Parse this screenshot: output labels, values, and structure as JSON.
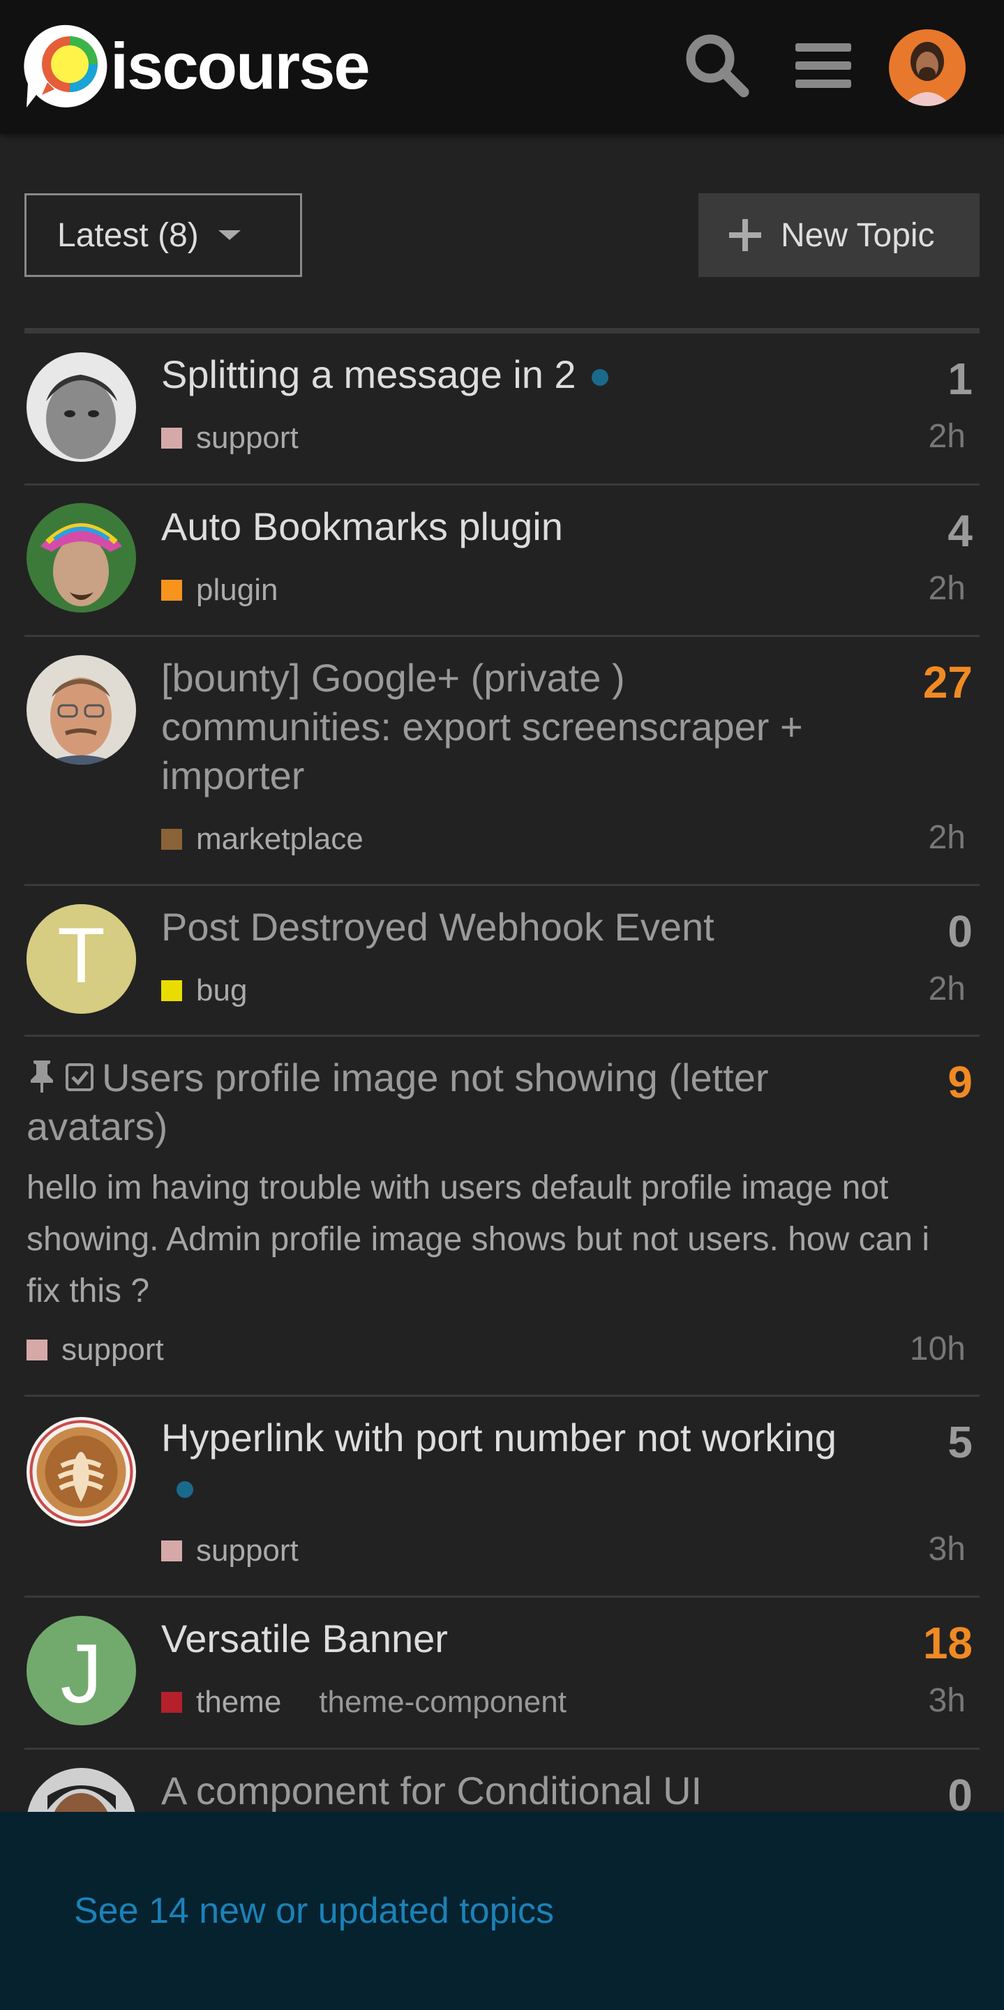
{
  "header": {
    "logo_text": "iscourse",
    "search_icon": "search-icon",
    "menu_icon": "hamburger-menu-icon",
    "avatar_icon": "user-avatar"
  },
  "controls": {
    "filter_label": "Latest (8)",
    "new_topic_label": "New Topic"
  },
  "topics": [
    {
      "title": "Splitting a message in 2",
      "category": "support",
      "category_color": "#d6a9a9",
      "posts": "1",
      "age": "2h",
      "unread_dot": true,
      "read": false,
      "hot": false
    },
    {
      "title": "Auto Bookmarks plugin",
      "category": "plugin",
      "category_color": "#f7941d",
      "posts": "4",
      "age": "2h",
      "unread_dot": false,
      "read": false,
      "hot": false
    },
    {
      "title": "[bounty] Google+ (private ) communities: export screenscraper + importer",
      "category": "marketplace",
      "category_color": "#8c6238",
      "posts": "27",
      "age": "2h",
      "unread_dot": false,
      "read": true,
      "hot": true
    },
    {
      "title": "Post Destroyed Webhook Event",
      "category": "bug",
      "category_color": "#e9dd00",
      "posts": "0",
      "age": "2h",
      "avatar_letter": "T",
      "read": true,
      "hot": false
    },
    {
      "title": "Users profile image not showing (letter avatars)",
      "excerpt": "hello im having trouble with users default profile image not showing. Admin profile image shows but not users. how can i fix this ?",
      "category": "support",
      "category_color": "#d6a9a9",
      "posts": "9",
      "age": "10h",
      "pinned": true,
      "read": true,
      "hot": true
    },
    {
      "title": "Hyperlink with port number not working",
      "category": "support",
      "category_color": "#d6a9a9",
      "posts": "5",
      "age": "3h",
      "unread_dot": true,
      "read": false,
      "hot": false
    },
    {
      "title": "Versatile Banner",
      "category": "theme",
      "category_color": "#b5202b",
      "tag": "theme-component",
      "posts": "18",
      "age": "3h",
      "avatar_letter": "J",
      "read": false,
      "hot": true
    },
    {
      "title": "A component for Conditional UI",
      "posts": "0",
      "read": true,
      "hot": false
    }
  ],
  "banner": {
    "text": "See 14 new or updated topics"
  }
}
